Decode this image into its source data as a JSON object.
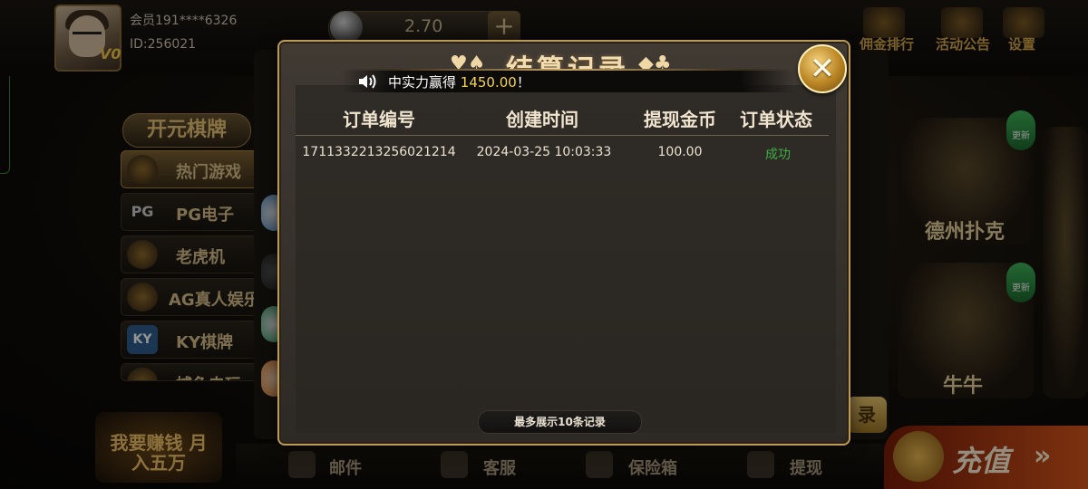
{
  "header": {
    "member_label": "会员191****6326",
    "id_label": "ID:256021",
    "vip_level": "V0",
    "balance": "2.70",
    "add_label": "+",
    "top_actions": [
      {
        "label": "佣金排行",
        "icon": "trophy-icon"
      },
      {
        "label": "活动公告",
        "icon": "gift-icon"
      },
      {
        "label": "设置",
        "icon": "gear-icon"
      }
    ]
  },
  "sidebar": {
    "brand": "开元棋牌",
    "items": [
      {
        "label": "热门游戏",
        "icon": "trophy-icon",
        "active": true
      },
      {
        "label": "PG电子",
        "icon": "pg-icon"
      },
      {
        "label": "老虎机",
        "icon": "slot-777-icon"
      },
      {
        "label": "AG真人娱乐",
        "icon": "ag-live-icon"
      },
      {
        "label": "KY棋牌",
        "icon": "ky-icon"
      },
      {
        "label": "捕鱼电玩",
        "icon": "fish-icon"
      }
    ],
    "promo": "我要赚钱 月入五万",
    "pg_badge": "PG",
    "ky_badge": "KY"
  },
  "games": [
    {
      "label": "德州扑克",
      "badge": "更新"
    },
    {
      "label": "牛牛",
      "badge": "更新"
    }
  ],
  "bottom_bar": [
    {
      "label": "邮件",
      "icon": "mail-icon"
    },
    {
      "label": "客服",
      "icon": "phone-icon"
    },
    {
      "label": "保险箱",
      "icon": "safe-icon"
    },
    {
      "label": "提现",
      "icon": "wallet-icon"
    }
  ],
  "recharge": {
    "label": "充值",
    "arrows": "»"
  },
  "modal": {
    "title": "结算记录",
    "suits_left": "♥♠",
    "suits_right": "◆♣",
    "marquee": {
      "prefix": "中实力赢得 ",
      "amount": "1450.00",
      "suffix": "！"
    },
    "close_label": "✕",
    "columns": [
      "订单编号",
      "创建时间",
      "提现金币",
      "订单状态"
    ],
    "rows": [
      {
        "order_id": "1711332213256021214",
        "created_at": "2024-03-25 10:03:33",
        "amount": "100.00",
        "status": "成功"
      }
    ],
    "footer_note": "最多展示10条记录",
    "side_button_label": "录"
  }
}
